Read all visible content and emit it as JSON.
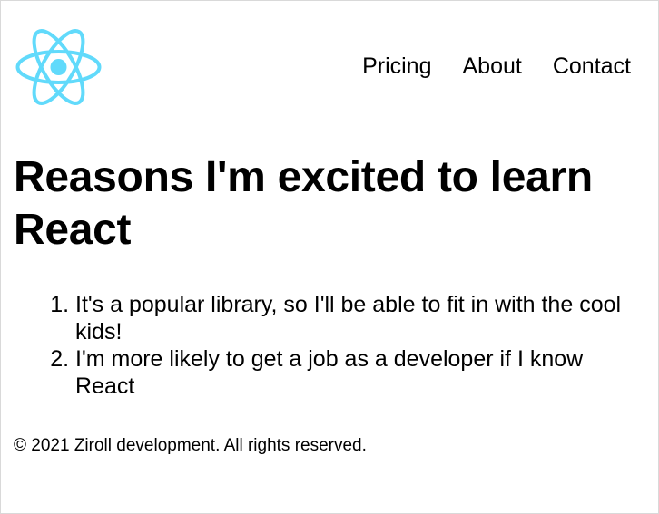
{
  "header": {
    "logo_icon": "react-logo-icon",
    "logo_color": "#61DAFB",
    "nav": [
      {
        "label": "Pricing"
      },
      {
        "label": "About"
      },
      {
        "label": "Contact"
      }
    ]
  },
  "main": {
    "title": "Reasons I'm excited to learn React",
    "reasons": [
      "It's a popular library, so I'll be able to fit in with the cool kids!",
      "I'm more likely to get a job as a developer if I know React"
    ]
  },
  "footer": {
    "text": "© 2021 Ziroll development. All rights reserved."
  }
}
